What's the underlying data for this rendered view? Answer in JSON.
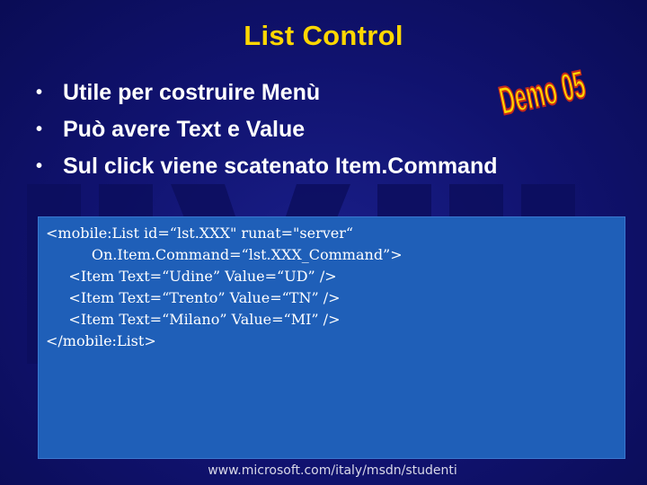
{
  "slide": {
    "title": "List Control",
    "demo_badge": "Demo 05",
    "bullets": [
      "Utile per costruire Menù",
      "Può avere Text e Value",
      "Sul click viene scatenato Item.Command"
    ],
    "bullet_marker": "•",
    "code_lines": [
      "<mobile:List id=“lst.XXX\" runat=\"server“",
      "          On.Item.Command=“lst.XXX_Command”>",
      "     <Item Text=“Udine” Value=“UD” />",
      "     <Item Text=“Trento” Value=“TN” />",
      "     <Item Text=“Milano” Value=“MI” />",
      "</mobile:List>"
    ],
    "footer": "www.microsoft.com/italy/msdn/studenti"
  },
  "colors": {
    "background": "#10126e",
    "title": "#ffd700",
    "code_box": "#1f5fb8",
    "demo_fill": "#ffd700",
    "demo_stroke": "#c62a1a"
  }
}
